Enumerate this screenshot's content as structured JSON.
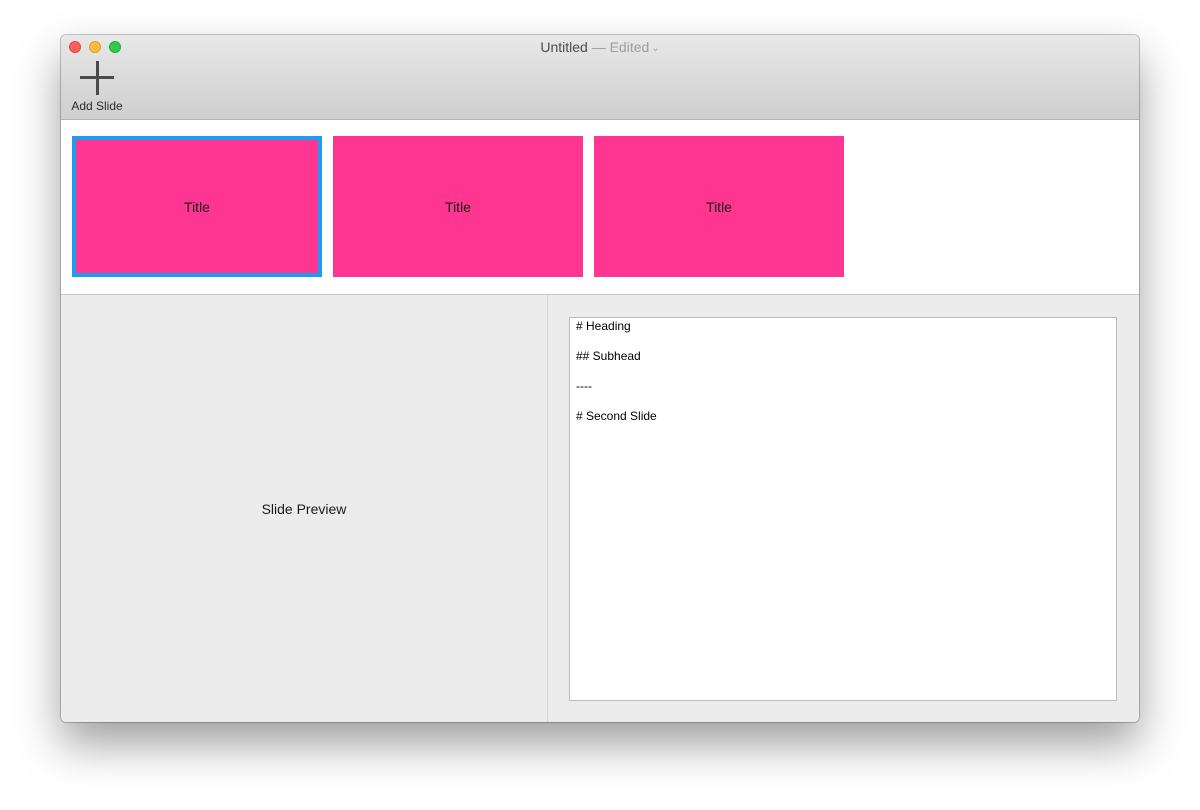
{
  "window": {
    "title": "Untitled",
    "separator": "—",
    "status": "Edited",
    "status_chevron": "⌄"
  },
  "toolbar": {
    "add_slide_label": "Add Slide",
    "add_slide_icon": "plus-icon"
  },
  "slides": [
    {
      "title": "Title",
      "selected": true
    },
    {
      "title": "Title",
      "selected": false
    },
    {
      "title": "Title",
      "selected": false
    }
  ],
  "preview": {
    "label": "Slide Preview"
  },
  "editor": {
    "lines": [
      "# Heading",
      "",
      "## Subhead",
      "",
      "----",
      "",
      "# Second Slide"
    ]
  },
  "colors": {
    "slide_background": "#ff3691",
    "selection": "#1f9bf0"
  }
}
